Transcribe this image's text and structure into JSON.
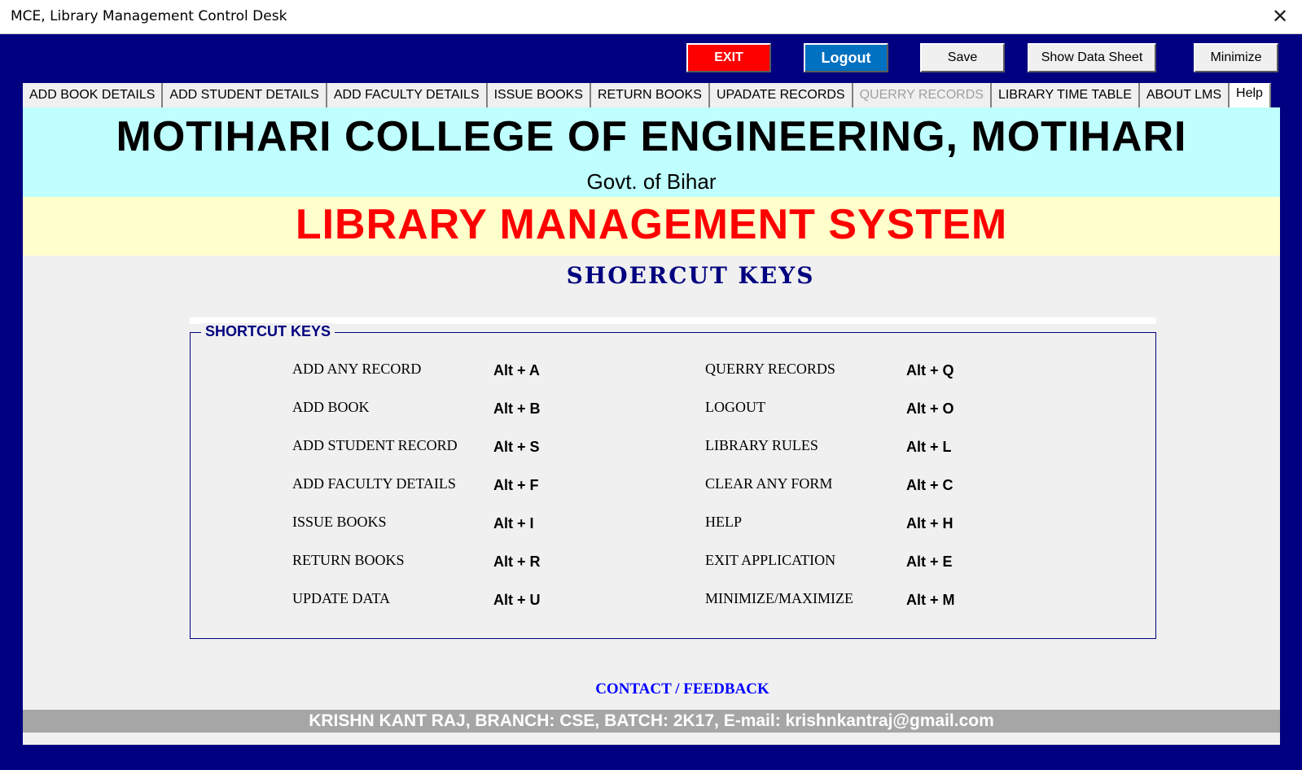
{
  "window": {
    "title": "MCE, Library Management Control Desk",
    "close_glyph": "✕"
  },
  "toolbar": {
    "exit": "EXIT",
    "logout": "Logout",
    "save": "Save",
    "show_data_sheet": "Show Data Sheet",
    "minimize": "Minimize"
  },
  "tabs": [
    {
      "label": "ADD BOOK DETAILS",
      "enabled": true
    },
    {
      "label": "ADD STUDENT DETAILS",
      "enabled": true
    },
    {
      "label": "ADD FACULTY DETAILS",
      "enabled": true
    },
    {
      "label": "ISSUE BOOKS",
      "enabled": true
    },
    {
      "label": "RETURN BOOKS",
      "enabled": true
    },
    {
      "label": "UPADATE RECORDS",
      "enabled": true
    },
    {
      "label": "QUERRY RECORDS",
      "enabled": false
    },
    {
      "label": "LIBRARY TIME TABLE",
      "enabled": true
    },
    {
      "label": "ABOUT LMS",
      "enabled": true
    },
    {
      "label": "Help",
      "enabled": true,
      "active": true
    }
  ],
  "header": {
    "college": "MOTIHARI COLLEGE OF ENGINEERING, MOTIHARI",
    "govt": "Govt. of Bihar",
    "system": "LIBRARY MANAGEMENT SYSTEM"
  },
  "page_heading": "SHOERCUT KEYS",
  "shortcuts": {
    "legend": "SHORTCUT KEYS",
    "left": [
      {
        "label": "ADD ANY RECORD",
        "key": "Alt + A"
      },
      {
        "label": "ADD BOOK",
        "key": "Alt + B"
      },
      {
        "label": "ADD STUDENT RECORD",
        "key": "Alt + S"
      },
      {
        "label": "ADD FACULTY DETAILS",
        "key": "Alt + F"
      },
      {
        "label": "ISSUE BOOKS",
        "key": "Alt + I"
      },
      {
        "label": "RETURN BOOKS",
        "key": "Alt + R"
      },
      {
        "label": "UPDATE DATA",
        "key": "Alt + U"
      }
    ],
    "right": [
      {
        "label": "QUERRY RECORDS",
        "key": "Alt + Q"
      },
      {
        "label": "LOGOUT",
        "key": "Alt + O"
      },
      {
        "label": "LIBRARY RULES",
        "key": "Alt + L"
      },
      {
        "label": "CLEAR ANY FORM",
        "key": "Alt + C"
      },
      {
        "label": "HELP",
        "key": "Alt + H"
      },
      {
        "label": "EXIT APPLICATION",
        "key": "Alt + E"
      },
      {
        "label": "MINIMIZE/MAXIMIZE",
        "key": "Alt + M"
      }
    ]
  },
  "contact": "CONTACT / FEEDBACK",
  "footer": "KRISHN KANT RAJ, BRANCH: CSE, BATCH: 2K17, E-mail: krishnkantraj@gmail.com",
  "colors": {
    "frame": "#000080",
    "exit_button": "#ff0000",
    "logout_button": "#0070c0",
    "header_cyan": "#bfffff",
    "header_yellow": "#ffffcc",
    "system_title": "#ff0000",
    "footer_bar": "#a6a6a6"
  }
}
